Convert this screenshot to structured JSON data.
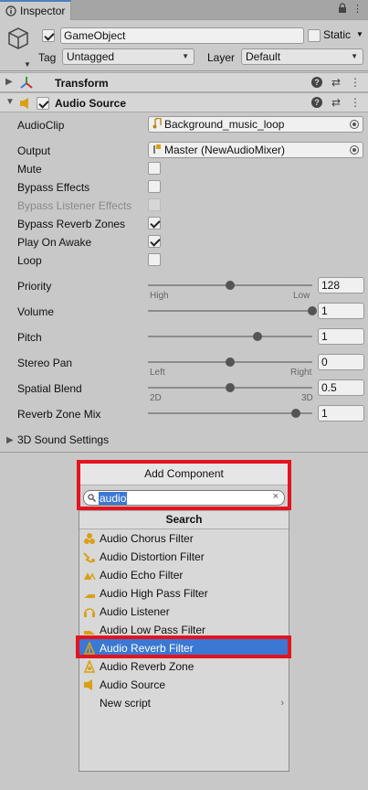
{
  "tab": {
    "title": "Inspector"
  },
  "gameobject": {
    "name": "GameObject",
    "static_label": "Static",
    "tag_label": "Tag",
    "tag_value": "Untagged",
    "layer_label": "Layer",
    "layer_value": "Default"
  },
  "components": {
    "transform": {
      "title": "Transform"
    },
    "audio_source": {
      "title": "Audio Source"
    }
  },
  "audio_source": {
    "audioclip_label": "AudioClip",
    "audioclip_value": "Background_music_loop",
    "output_label": "Output",
    "output_value": "Master (NewAudioMixer)",
    "mute_label": "Mute",
    "bypass_effects_label": "Bypass Effects",
    "bypass_listener_label": "Bypass Listener Effects",
    "bypass_reverb_label": "Bypass Reverb Zones",
    "play_on_awake_label": "Play On Awake",
    "loop_label": "Loop",
    "priority_label": "Priority",
    "priority_value": "128",
    "priority_min_label": "High",
    "priority_max_label": "Low",
    "volume_label": "Volume",
    "volume_value": "1",
    "pitch_label": "Pitch",
    "pitch_value": "1",
    "stereo_pan_label": "Stereo Pan",
    "stereo_pan_value": "0",
    "stereo_min_label": "Left",
    "stereo_max_label": "Right",
    "spatial_blend_label": "Spatial Blend",
    "spatial_blend_value": "0.5",
    "spatial_min_label": "2D",
    "spatial_max_label": "3D",
    "reverb_zone_mix_label": "Reverb Zone Mix",
    "reverb_zone_mix_value": "1",
    "sound3d_label": "3D Sound Settings",
    "checkbox_states": {
      "mute": false,
      "bypass_effects": false,
      "bypass_listener": false,
      "bypass_reverb": true,
      "play_on_awake": true,
      "loop": false
    },
    "slider_levels": {
      "priority": 0.5,
      "volume": 1.0,
      "pitch": 0.667,
      "stereo_pan": 0.5,
      "spatial_blend": 0.5,
      "reverb_zone_mix": 0.9
    }
  },
  "popup": {
    "title": "Add Component",
    "search_value": "audio",
    "section_title": "Search",
    "items": [
      {
        "label": "Audio Chorus Filter",
        "icon": "chorus-filter-icon"
      },
      {
        "label": "Audio Distortion Filter",
        "icon": "distortion-filter-icon"
      },
      {
        "label": "Audio Echo Filter",
        "icon": "echo-filter-icon"
      },
      {
        "label": "Audio High Pass Filter",
        "icon": "high-pass-filter-icon"
      },
      {
        "label": "Audio Listener",
        "icon": "listener-icon"
      },
      {
        "label": "Audio Low Pass Filter",
        "icon": "low-pass-filter-icon"
      },
      {
        "label": "Audio Reverb Filter",
        "icon": "reverb-filter-icon"
      },
      {
        "label": "Audio Reverb Zone",
        "icon": "reverb-zone-icon"
      },
      {
        "label": "Audio Source",
        "icon": "audio-source-icon"
      },
      {
        "label": "New script",
        "icon": ""
      }
    ],
    "selected_index": 6
  },
  "colors": {
    "highlight": "#e3141e",
    "selection": "#3a78d4",
    "audio_icon": "#d9a017"
  }
}
